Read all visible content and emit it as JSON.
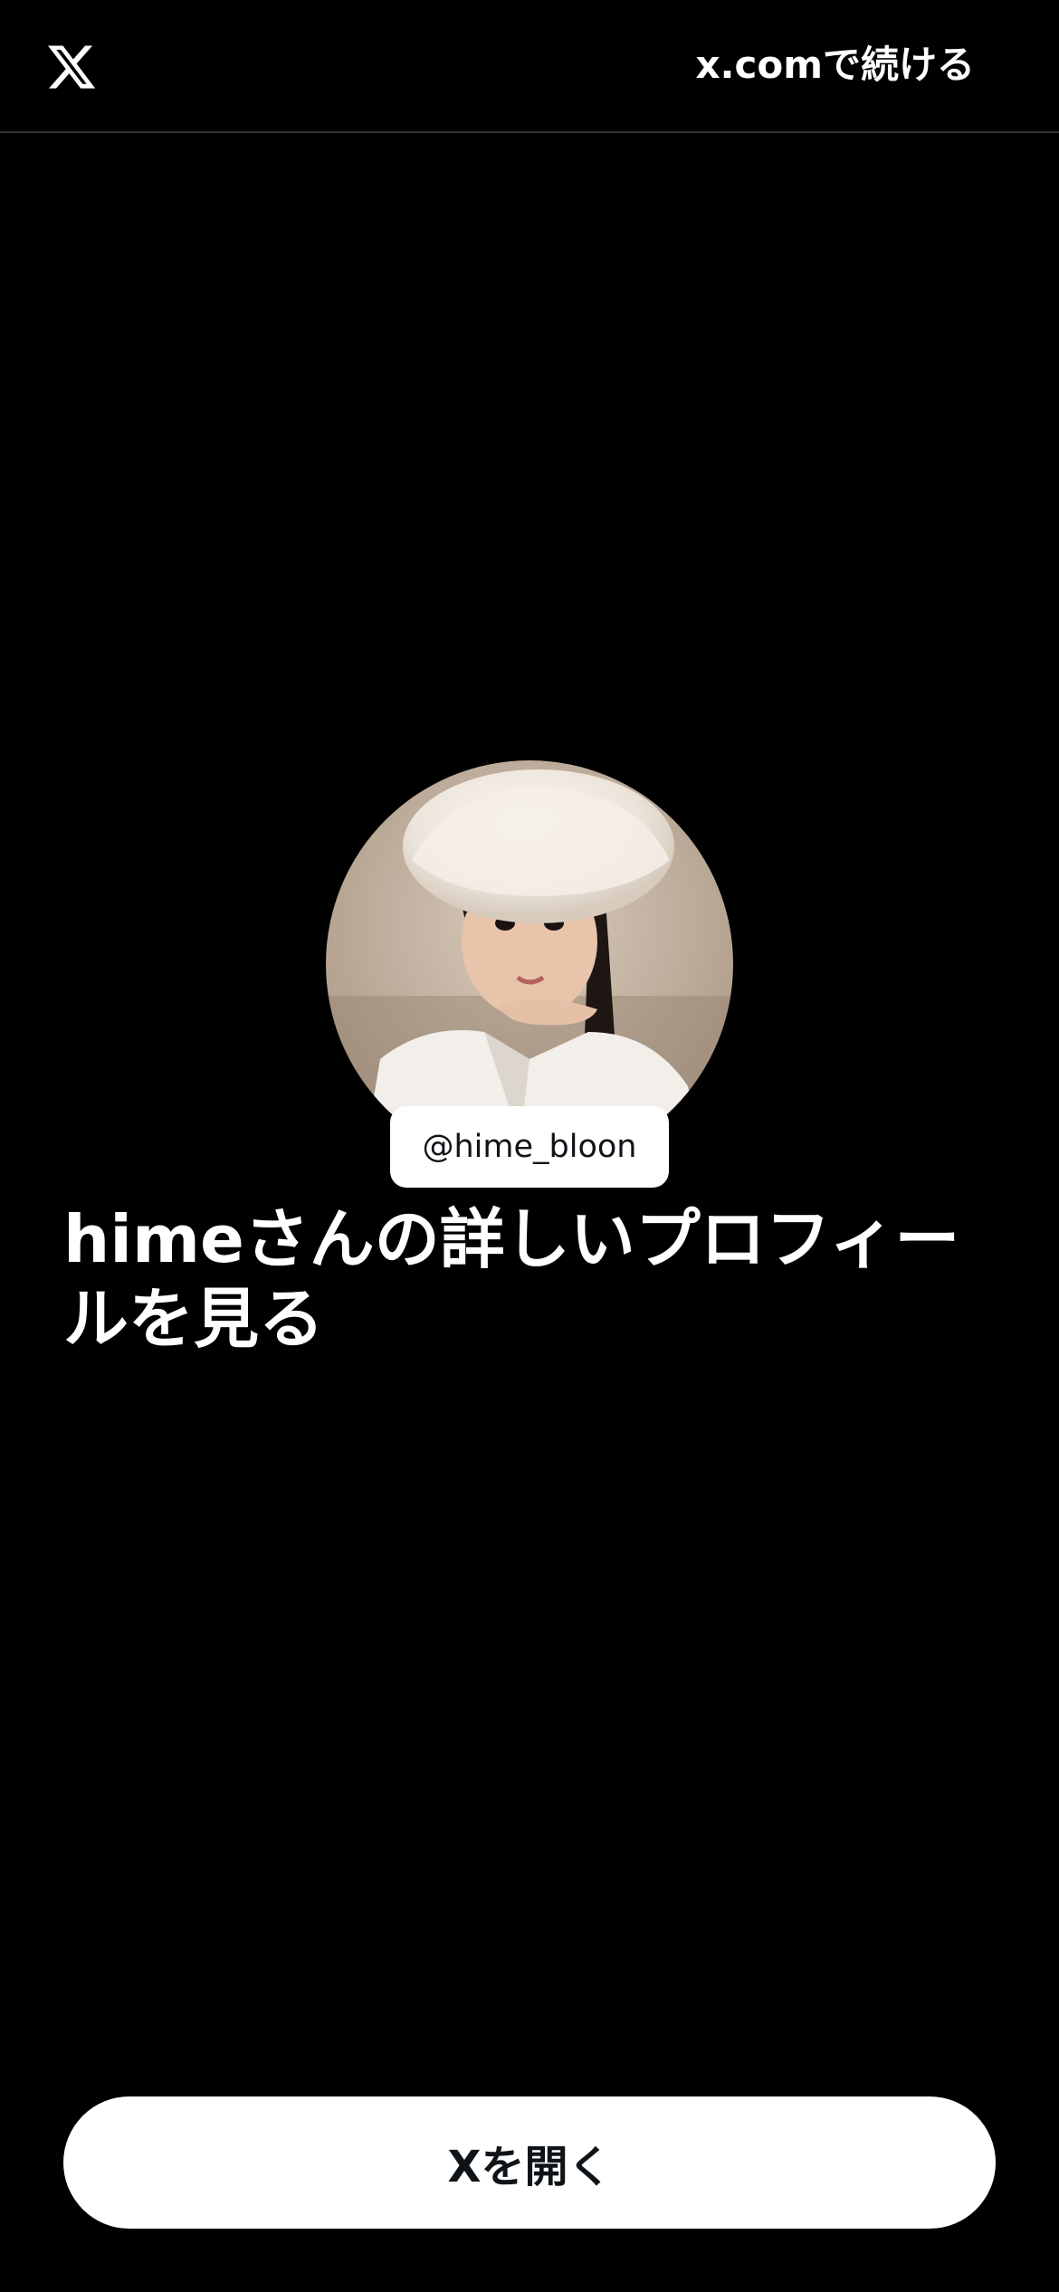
{
  "header": {
    "logo_icon": "x-logo-icon",
    "continue_label": "x.comで続ける"
  },
  "profile": {
    "avatar_description_icon": "profile-avatar",
    "handle": "@hime_bloon",
    "heading": "himeさんの詳しいプロフィールを見る"
  },
  "footer": {
    "open_button_label": "Xを開く"
  },
  "colors": {
    "background": "#000000",
    "text": "#ffffff",
    "button_bg": "#ffffff",
    "button_text": "#0f1419",
    "divider": "#2f3336"
  }
}
